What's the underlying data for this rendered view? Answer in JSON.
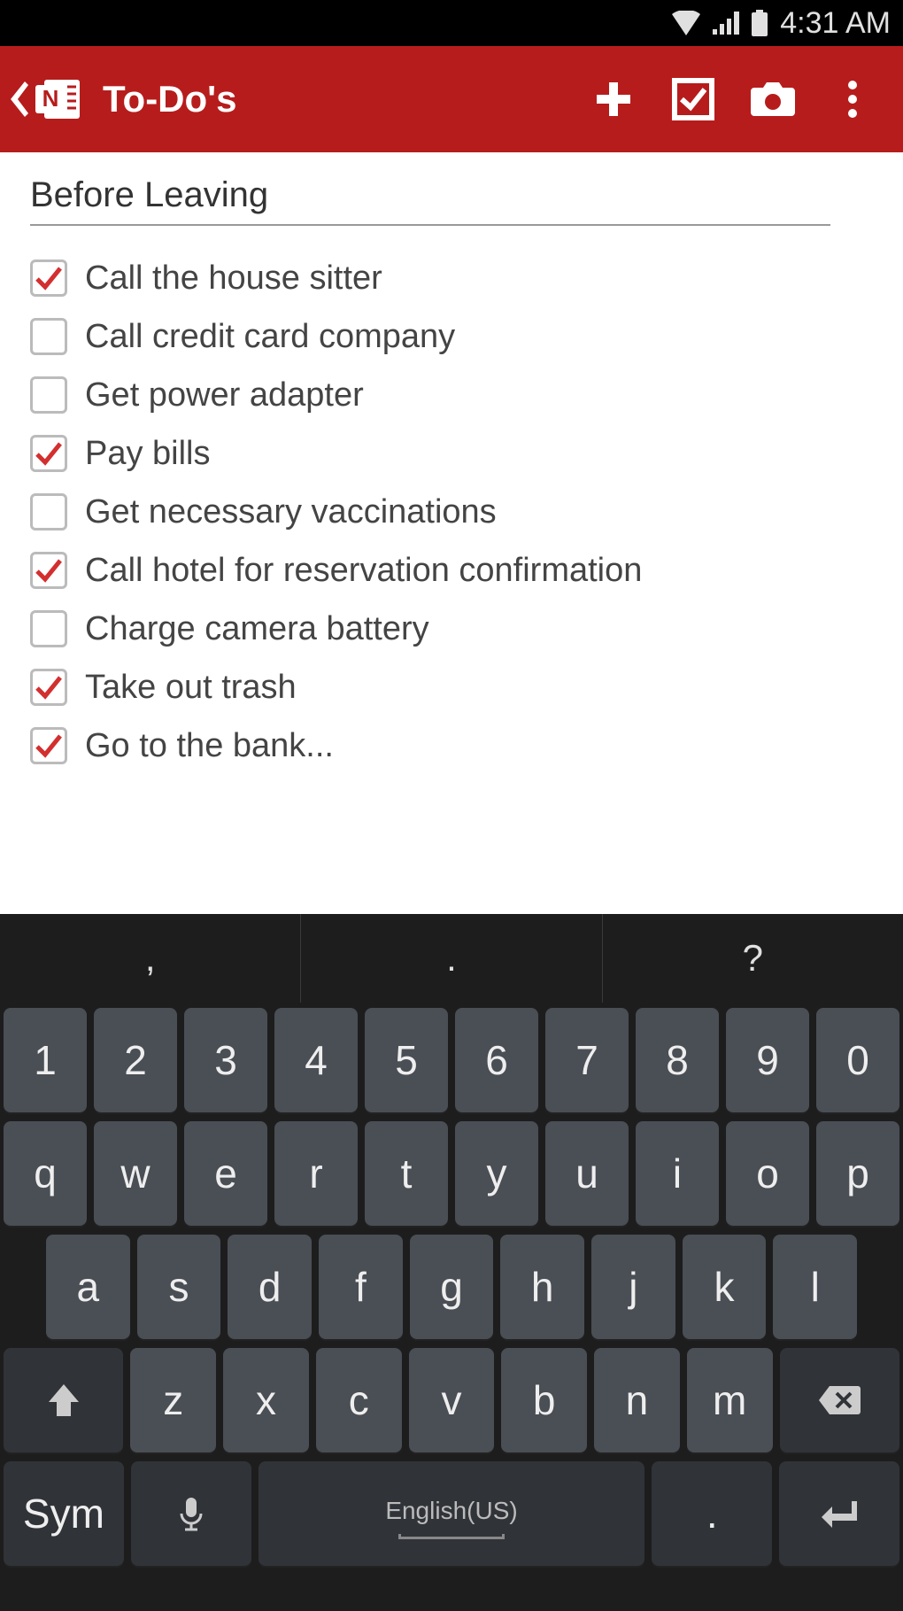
{
  "status": {
    "time": "4:31 AM"
  },
  "actionbar": {
    "title": "To-Do's"
  },
  "note": {
    "title": "Before Leaving",
    "items": [
      {
        "label": "Call the house sitter",
        "checked": true
      },
      {
        "label": "Call credit card company",
        "checked": false
      },
      {
        "label": "Get power adapter",
        "checked": false
      },
      {
        "label": "Pay bills",
        "checked": true
      },
      {
        "label": "Get necessary vaccinations",
        "checked": false
      },
      {
        "label": "Call hotel for reservation confirmation",
        "checked": true
      },
      {
        "label": "Charge camera battery",
        "checked": false
      },
      {
        "label": "Take out trash",
        "checked": true
      },
      {
        "label": "Go to the bank...",
        "checked": true
      }
    ]
  },
  "keyboard": {
    "suggestions": [
      ",",
      ".",
      "?"
    ],
    "row_digits": [
      "1",
      "2",
      "3",
      "4",
      "5",
      "6",
      "7",
      "8",
      "9",
      "0"
    ],
    "row_qwerty": [
      "q",
      "w",
      "e",
      "r",
      "t",
      "y",
      "u",
      "i",
      "o",
      "p"
    ],
    "row_asdf": [
      "a",
      "s",
      "d",
      "f",
      "g",
      "h",
      "j",
      "k",
      "l"
    ],
    "row_zxcv": [
      "z",
      "x",
      "c",
      "v",
      "b",
      "n",
      "m"
    ],
    "sym": "Sym",
    "space": "English(US)"
  }
}
